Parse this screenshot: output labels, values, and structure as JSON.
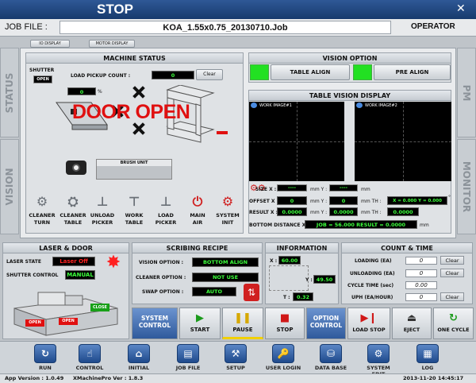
{
  "title": "STOP",
  "close_glyph": "✕",
  "job": {
    "label": "JOB FILE :",
    "value": "KOA_1.55x0.75_20130710.Job",
    "role": "OPERATOR"
  },
  "display_tabs": {
    "io": "IO DISPLAY",
    "motor": "MOTOR DISPLAY"
  },
  "side_tabs": {
    "status": "STATUS",
    "vision": "VISION",
    "pm": "PM",
    "monitor": "MONITOR"
  },
  "machine_status": {
    "title": "MACHINE STATUS",
    "shutter_label": "SHUTTER",
    "shutter_value": "OPEN",
    "pickup_label": "LOAD PICKUP COUNT :",
    "pickup_value": "0",
    "clear": "Clear",
    "percent_value": "0",
    "percent_unit": "%",
    "door_text": "DOOR OPEN",
    "brush_unit": "BRUSH UNIT",
    "buttons": [
      {
        "line1": "CLEANER",
        "line2": "TURN",
        "icon": "cleaner-turn-icon"
      },
      {
        "line1": "CLEANER",
        "line2": "TABLE",
        "icon": "cleaner-table-icon"
      },
      {
        "line1": "UNLOAD",
        "line2": "PICKER",
        "icon": "unload-picker-icon"
      },
      {
        "line1": "WORK",
        "line2": "TABLE",
        "icon": "work-table-icon"
      },
      {
        "line1": "LOAD",
        "line2": "PICKER",
        "icon": "load-picker-icon"
      },
      {
        "line1": "MAIN",
        "line2": "AIR",
        "icon": "main-air-icon"
      },
      {
        "line1": "SYSTEM",
        "line2": "INIT",
        "icon": "system-init-icon"
      }
    ]
  },
  "vision_option": {
    "title": "VISION OPTION",
    "table_align": "TABLE ALIGN",
    "pre_align": "PRE ALIGN",
    "indicator_color": "#22e022"
  },
  "table_vision": {
    "title": "TABLE VISION DISPLAY",
    "image1": "WORK IMAGE#1",
    "image2": "WORK IMAGE#2",
    "size_label": "SIZE X :",
    "size_x": "----",
    "size_y": "----",
    "offset_label": "OFFSET X :",
    "offset_x": "0",
    "offset_y": "0",
    "result_label": "RESULT X :",
    "result_x": "0.0000",
    "result_y": "0.0000",
    "unit_mm_y": "mm Y :",
    "unit_mm": "mm",
    "th_label": "mm TH :",
    "offset_th": "X = 0.000  Y = 0.000",
    "result_th": "0.0000",
    "degree": "°",
    "bottom_label": "BOTTOM DISTANCE X :",
    "bottom_value": "JOB = 56.000  RESULT = 0.0000"
  },
  "laser": {
    "title": "LASER & DOOR",
    "state_label": "LASER STATE",
    "state_value": "Laser Off",
    "shutter_label": "SHUTTER CONTROL",
    "shutter_value": "MANUAL",
    "close": "CLOSE",
    "open1": "OPEN",
    "open2": "OPEN"
  },
  "scribing": {
    "title": "SCRIBING RECIPE",
    "vision_label": "VISION OPTION :",
    "vision_value": "BOTTOM ALIGN",
    "cleaner_label": "CLEANER OPTION :",
    "cleaner_value": "NOT USE",
    "swap_label": "SWAP OPTION :",
    "swap_value": "AUTO"
  },
  "information": {
    "title": "INFORMATION",
    "x_label": "X :",
    "x_value": "60.00",
    "y_label": "Y :",
    "y_value": "49.50",
    "t_label": "T :",
    "t_value": "0.32"
  },
  "count": {
    "title": "COUNT & TIME",
    "rows": [
      {
        "label": "LOADING (EA)",
        "value": "0",
        "clear": "Clear"
      },
      {
        "label": "UNLOADING (EA)",
        "value": "0",
        "clear": "Clear"
      },
      {
        "label": "CYCLE TIME (sec)",
        "value": "0.00"
      },
      {
        "label": "UPH (EA/HOUR)",
        "value": "0",
        "clear": "Clear"
      }
    ]
  },
  "controls": {
    "system_control": "SYSTEM CONTROL",
    "start": "START",
    "pause": "PAUSE",
    "stop": "STOP",
    "option_control": "OPTION CONTROL",
    "load_stop": "LOAD STOP",
    "eject": "EJECT",
    "one_cycle": "ONE CYCLE"
  },
  "nav": [
    "RUN",
    "CONTROL",
    "INITIAL",
    "JOB FILE",
    "SETUP",
    "USER LOGIN",
    "DATA BASE",
    "SYSTEM EDIT",
    "LOG"
  ],
  "status_bar": {
    "app_version": "App Version : 1.0.49",
    "xmp_version": "XMachinePro Ver : 1.8.3",
    "datetime": "2013-11-20 14:45:17"
  },
  "colors": {
    "title_bar": "#1e3f72",
    "door_red": "#e01010",
    "laser_red": "#ff2020",
    "nav_blue": "#2a5aa0"
  }
}
